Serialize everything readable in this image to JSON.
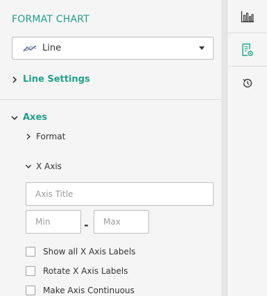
{
  "panel": {
    "title": "FORMAT CHART",
    "chart_type": {
      "selected": "Line",
      "icon": "line-chart-icon"
    },
    "sections": {
      "line_settings": {
        "label": "Line Settings",
        "expanded": false
      },
      "axes": {
        "label": "Axes",
        "expanded": true
      }
    },
    "axes": {
      "format": {
        "label": "Format",
        "expanded": false
      },
      "x_axis": {
        "label": "X Axis",
        "expanded": true,
        "title_placeholder": "Axis Title",
        "min_placeholder": "Min",
        "range_separator": "-",
        "max_placeholder": "Max",
        "options": [
          {
            "label": "Show all X Axis Labels",
            "checked": false
          },
          {
            "label": "Rotate X Axis Labels",
            "checked": false
          },
          {
            "label": "Make Axis Continuous",
            "checked": false
          }
        ]
      }
    }
  },
  "rail": {
    "buttons": [
      {
        "name": "chart",
        "icon": "bar-chart-icon"
      },
      {
        "name": "format",
        "icon": "format-settings-icon"
      },
      {
        "name": "history",
        "icon": "history-icon"
      }
    ]
  },
  "colors": {
    "accent": "#21a08a",
    "text": "#333333",
    "border": "#bdbdbd",
    "panel_bg": "#f5f5f5"
  }
}
